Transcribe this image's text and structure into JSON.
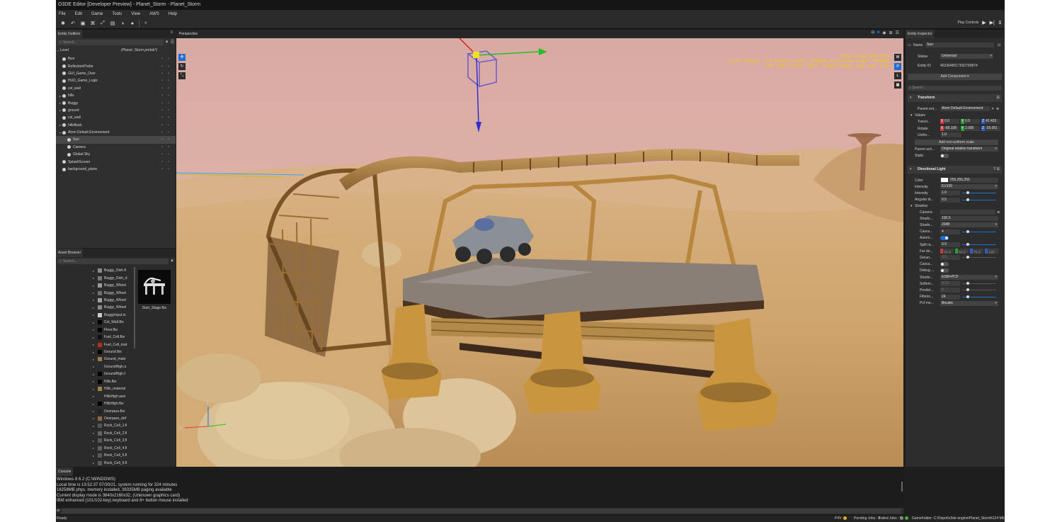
{
  "window": {
    "title": "O3DE Editor [Developer Preview] - Planet_Storm - Planet_Storm"
  },
  "menu": [
    "File",
    "Edit",
    "Game",
    "Tools",
    "View",
    "AWS",
    "Help"
  ],
  "toolbar": {
    "play_controls_label": "Play Controls"
  },
  "outliner": {
    "tab": "Entity Outliner",
    "search_placeholder": "Search...",
    "level_label": "Level",
    "level_prefab": "(Planet_Storm.prefab*)",
    "items": [
      {
        "label": "floor",
        "depth": 1,
        "expandable": false,
        "selected": false
      },
      {
        "label": "ReflectionProbe",
        "depth": 1,
        "expandable": false,
        "selected": false
      },
      {
        "label": "GUI_Game_Over",
        "depth": 1,
        "expandable": false,
        "selected": false
      },
      {
        "label": "HUD_Game_Logic",
        "depth": 1,
        "expandable": false,
        "selected": false
      },
      {
        "label": "col_wall",
        "depth": 1,
        "expandable": false,
        "selected": false
      },
      {
        "label": "hills",
        "depth": 1,
        "expandable": true,
        "selected": false
      },
      {
        "label": "Buggy",
        "depth": 1,
        "expandable": true,
        "selected": false
      },
      {
        "label": "ground",
        "depth": 1,
        "expandable": true,
        "selected": false
      },
      {
        "label": "col_wall",
        "depth": 1,
        "expandable": false,
        "selected": false
      },
      {
        "label": "hillsBack",
        "depth": 1,
        "expandable": true,
        "selected": false
      },
      {
        "label": "Atom Default Environment",
        "depth": 1,
        "expandable": true,
        "selected": false
      },
      {
        "label": "Sun",
        "depth": 2,
        "expandable": false,
        "selected": true
      },
      {
        "label": "Camera",
        "depth": 2,
        "expandable": false,
        "selected": false
      },
      {
        "label": "Global Sky",
        "depth": 2,
        "expandable": false,
        "selected": false
      },
      {
        "label": "SplashScreen",
        "depth": 1,
        "expandable": false,
        "selected": false
      },
      {
        "label": "background_plane",
        "depth": 1,
        "expandable": false,
        "selected": false
      }
    ]
  },
  "asset_browser": {
    "tab": "Asset Browser",
    "search_placeholder": "Search...",
    "items": [
      {
        "label": "Buggy_Dish.fl",
        "thumb": "#8a8a8a"
      },
      {
        "label": "Buggy_Dish_d",
        "thumb": "#777777"
      },
      {
        "label": "Buggy_Wheel",
        "thumb": "#9a9a9a"
      },
      {
        "label": "Buggy_Wheel",
        "thumb": "#6f6f6f"
      },
      {
        "label": "Buggy_Wheel",
        "thumb": "#a0a0a0"
      },
      {
        "label": "Buggy_Wheel",
        "thumb": "#888888"
      },
      {
        "label": "BuggyInput.in",
        "thumb": "#cccccc"
      },
      {
        "label": "Col_Wall.fbx",
        "thumb": "#000000"
      },
      {
        "label": "Floor.fbx",
        "thumb": "#000000"
      },
      {
        "label": "Fuel_Cell.fbx",
        "thumb": "#111111"
      },
      {
        "label": "Fuel_Cell_mat",
        "thumb": "#b03020"
      },
      {
        "label": "Ground.fbx",
        "thumb": "#000000"
      },
      {
        "label": "Ground_mate",
        "thumb": "#9a7a50"
      },
      {
        "label": "GroundHigh.a",
        "thumb": "#2b2b2b"
      },
      {
        "label": "GroundHigh.f",
        "thumb": "#000000"
      },
      {
        "label": "Hills.fbx",
        "thumb": "#000000"
      },
      {
        "label": "Hills_material",
        "thumb": "#a08050"
      },
      {
        "label": "HillsHigh.assi",
        "thumb": "#2b2b2b"
      },
      {
        "label": "HillsHigh.fbx",
        "thumb": "#000000"
      },
      {
        "label": "Overpass.fbx",
        "thumb": "#222222"
      },
      {
        "label": "Overpass_def",
        "thumb": "#8a6a40"
      },
      {
        "label": "Rock_Cell_1.fl",
        "thumb": "#555555"
      },
      {
        "label": "Rock_Cell_2.fl",
        "thumb": "#666666"
      },
      {
        "label": "Rock_Cell_3.fl",
        "thumb": "#5a5a5a"
      },
      {
        "label": "Rock_Cell_4.fl",
        "thumb": "#606060"
      },
      {
        "label": "Rock_Cell_5.fl",
        "thumb": "#585858"
      },
      {
        "label": "Rock_Cell_6.fl",
        "thumb": "#5c5c5c"
      }
    ],
    "preview_label": "Start_Stage.fbx"
  },
  "viewport": {
    "tab": "Perspective",
    "stats": [
      "Atom using DX12 RHI",
      "Total Passes: 173 Vertex Count: 2678963 Primitive Count: 893064",
      "FPS 262.0 [231..313], 3.8ms/frame, avg over 1.0s"
    ],
    "view_buttons": [
      "W",
      "P",
      "L"
    ]
  },
  "inspector": {
    "tab": "Entity Inspector",
    "name_label": "Name",
    "name_value": "Sun",
    "status_label": "Status",
    "status_value": "Universal",
    "entity_id_label": "Entity ID",
    "entity_id_value": "4623648017692790874",
    "add_component": "Add Component",
    "search_placeholder": "Search...",
    "transform": {
      "title": "Transform",
      "parent_entity_label": "Parent ent...",
      "parent_entity_value": "Atom Default Environment",
      "values_label": "Values",
      "translate_label": "Transl...",
      "translate": {
        "x": "0.0",
        "y": "0.0",
        "z": "42.433"
      },
      "rotate_label": "Rotate",
      "rotate": {
        "x": "-68.108",
        "y": "2.085",
        "z": "-26.051"
      },
      "uniform_label": "Unifor...",
      "uniform_value": "1.0",
      "add_nonuniform": "Add non-uniform scale",
      "parent_activation_label": "Parent acti...",
      "parent_activation_value": "Original relative transform",
      "static_label": "Static"
    },
    "directional_light": {
      "title": "Directional Light",
      "rows": [
        {
          "label": "Color",
          "value": "255,255,255",
          "kind": "color"
        },
        {
          "label": "Intensity",
          "value": "EV100",
          "kind": "combo"
        },
        {
          "label": "Intensity",
          "value": "1.0",
          "kind": "slider"
        },
        {
          "label": "Angular di...",
          "value": "0.5",
          "kind": "slider"
        }
      ],
      "shadow_label": "Shadow",
      "shadow_rows": [
        {
          "label": "Camera",
          "value": "",
          "kind": "picker"
        },
        {
          "label": "Shado...",
          "value": "100.0",
          "kind": "field"
        },
        {
          "label": "Shado...",
          "value": "2048",
          "kind": "combo"
        },
        {
          "label": "Casca...",
          "value": "4",
          "kind": "slider"
        },
        {
          "label": "Autom...",
          "value": "",
          "kind": "toggle-on"
        },
        {
          "label": "Split ra...",
          "value": "0.9",
          "kind": "slider"
        },
        {
          "label": "Far de...",
          "value": "",
          "kind": "far"
        },
        {
          "label": "Groun...",
          "value": "0.0",
          "kind": "dim"
        },
        {
          "label": "Casca...",
          "value": "",
          "kind": "toggle"
        },
        {
          "label": "Debug ...",
          "value": "",
          "kind": "toggle"
        },
        {
          "label": "Shado...",
          "value": "ESM+PCF",
          "kind": "combo"
        },
        {
          "label": "Softeni...",
          "value": "0.03",
          "kind": "dim"
        },
        {
          "label": "Predict...",
          "value": "8",
          "kind": "dim"
        },
        {
          "label": "Filterin...",
          "value": "24",
          "kind": "slider"
        },
        {
          "label": "Pcf me...",
          "value": "Bicubic",
          "kind": "combo"
        }
      ],
      "far_values": [
        "25.0",
        "50.0",
        "75.0",
        "100"
      ]
    }
  },
  "console": {
    "tab": "Console",
    "lines": [
      "Windows 8 6.2 (C:\\WINDOWS)",
      "Local time is 13:52:37 07/30/21, system running for 324 minutes",
      "16258MB phys. memory installed, 39335MB paging available",
      "Current display mode is 3840x2160x32, (Unknown graphics card)",
      "IBM enhanced (101/102-key) keyboard and 8+ button mouse installed"
    ],
    "prompt": "ar"
  },
  "status": {
    "ready": "Ready",
    "p4v": "P4V",
    "pending_jobs": "Pending Jobs : 0",
    "failed_jobs": "Failed Jobs : 0",
    "game_folder": "GameFolder: C:\\Depot\\o3de-engine\\Planet_Storm",
    "memory": "6124 Mb"
  },
  "colors": {
    "accent": "#1e6fd2",
    "selected_row": "#484848",
    "stats_text": "#f0d000"
  }
}
